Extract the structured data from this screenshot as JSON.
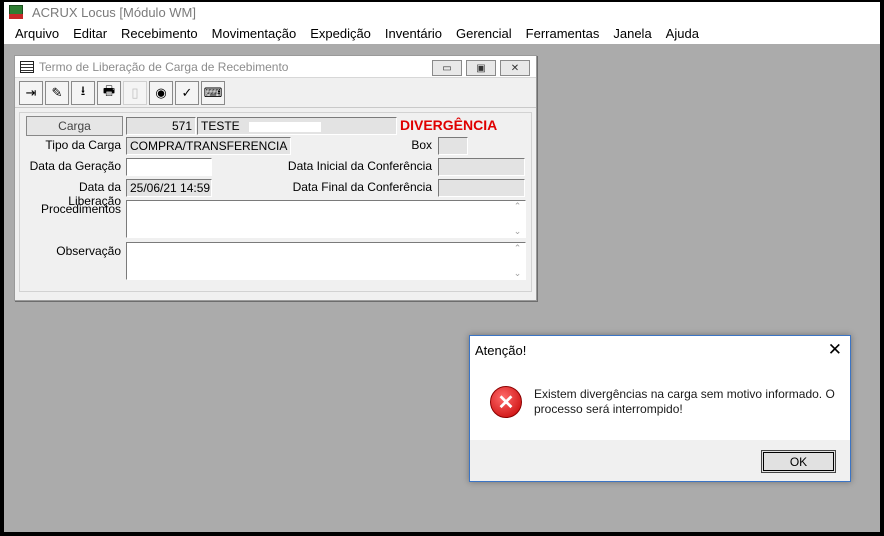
{
  "app": {
    "title": "ACRUX Locus [Módulo WM]",
    "icon": "app-logo-icon"
  },
  "menu": [
    "Arquivo",
    "Editar",
    "Recebimento",
    "Movimentação",
    "Expedição",
    "Inventário",
    "Gerencial",
    "Ferramentas",
    "Janela",
    "Ajuda"
  ],
  "child_window": {
    "title": "Termo de Liberação de Carga de Recebimento",
    "window_buttons": {
      "minimize": "▭",
      "restore": "▣",
      "close": "✕"
    },
    "toolbar": [
      {
        "name": "exit-icon",
        "glyph": "⇥"
      },
      {
        "name": "edit-icon",
        "glyph": "✎"
      },
      {
        "name": "download-icon",
        "glyph": "⭳"
      },
      {
        "name": "print-icon",
        "glyph": "🖶"
      },
      {
        "name": "disabled-icon",
        "glyph": "▯"
      },
      {
        "name": "search-icon",
        "glyph": "◉"
      },
      {
        "name": "task-icon",
        "glyph": "✓"
      },
      {
        "name": "keyboard-icon",
        "glyph": "⌨"
      }
    ],
    "form": {
      "carga_button": "Carga",
      "carga_number": "571",
      "carga_name": "TESTE",
      "status": "DIVERGÊNCIA",
      "tipo_label": "Tipo da Carga",
      "tipo_value": "COMPRA/TRANSFERENCIA",
      "box_label": "Box",
      "box_value": "",
      "geracao_label": "Data da Geração",
      "geracao_value": "",
      "inicial_label": "Data Inicial da Conferência",
      "inicial_value": "",
      "liberacao_label": "Data da Liberação",
      "liberacao_value": "25/06/21  14:59",
      "final_label": "Data Final da Conferência",
      "final_value": "",
      "procedimentos_label": "Procedimentos",
      "observacao_label": "Observação"
    }
  },
  "dialog": {
    "title": "Atenção!",
    "message": "Existem divergências na carga sem motivo informado. O processo será interrompido!",
    "ok": "OK",
    "icon": "error-icon"
  },
  "colors": {
    "status_red": "#e00000",
    "desktop_gray": "#ababab",
    "dialog_border": "#3b74c4"
  }
}
